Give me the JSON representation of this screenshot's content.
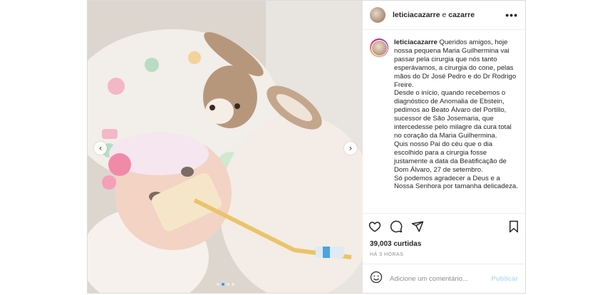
{
  "media": {
    "prev_icon": "‹",
    "next_icon": "›",
    "slides": 4,
    "active_slide": 1
  },
  "header": {
    "user1": "leticiacazarre",
    "connector": "e",
    "user2": "cazarre",
    "more_icon": "•••"
  },
  "caption": {
    "username": "leticiacazarre",
    "paragraphs": [
      "Queridos amigos, hoje nossa pequena Maria Guilhermina vai passar pela cirurgia que nós tanto esperávamos, a cirurgia do cone, pelas mãos do Dr José Pedro e do Dr Rodrigo Freire.",
      "Desde o início, quando recebemos o diagnóstico de Anomalia de Ebstein, pedimos ao Beato Álvaro del Portillo, sucessor de São Josemaria, que intercedesse pelo milagre da cura total no coração da Maria Guilhermina.",
      "Quis nosso Pai do céu que o dia escolhido para a cirurgia fosse justamente a data da Beatificação de Dom Álvaro, 27 de setembro.",
      "Só podemos agradecer a Deus e a Nossa Senhora por tamanha delicadeza."
    ]
  },
  "stats": {
    "likes": "39,003 curtidas",
    "time": "HÁ 3 HORAS"
  },
  "comment": {
    "placeholder": "Adicione um comentário...",
    "publish": "Publicar"
  },
  "colors": {
    "accent": "#3897f0",
    "publish_disabled": "#b2dffc",
    "border": "#dbdbdb"
  }
}
